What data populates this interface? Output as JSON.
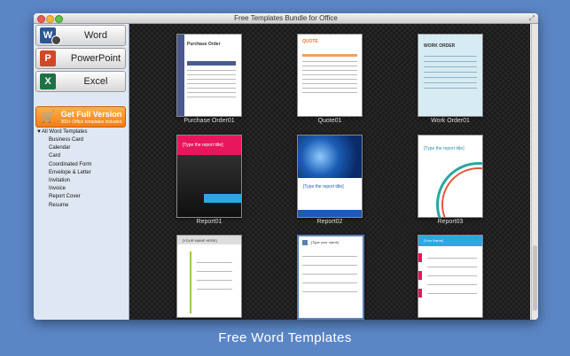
{
  "window": {
    "title": "Free Templates Bundle for Office"
  },
  "sidebar": {
    "apps": [
      {
        "label": "Word",
        "icon": "word-icon",
        "color": "#2b5797",
        "letter": "W"
      },
      {
        "label": "PowerPoint",
        "icon": "powerpoint-icon",
        "color": "#d24726",
        "letter": "P"
      },
      {
        "label": "Excel",
        "icon": "excel-icon",
        "color": "#1e7145",
        "letter": "X"
      }
    ],
    "get_full": {
      "title": "Get Full Version",
      "subtitle": "300+ Office templates included"
    },
    "category_header": "All Word Templates",
    "categories": [
      "Business Card",
      "Calendar",
      "Card",
      "Coordinated Form",
      "Envelope & Letter",
      "Invitation",
      "Invoice",
      "Report Cover",
      "Resume"
    ]
  },
  "templates": [
    {
      "label": "Purchase Order01",
      "thumb": {
        "heading": "Purchase Order"
      }
    },
    {
      "label": "Quote01",
      "thumb": {
        "heading": "QUOTE"
      }
    },
    {
      "label": "Work Order01",
      "thumb": {
        "heading": "WORK ORDER"
      }
    },
    {
      "label": "Report01",
      "thumb": {
        "heading": "[Type the report title]"
      }
    },
    {
      "label": "Report02",
      "thumb": {
        "heading": "[Type the report title]"
      }
    },
    {
      "label": "Report03",
      "thumb": {
        "heading": "[Type the report title]"
      }
    },
    {
      "label": "",
      "thumb": {
        "heading": "[YOUR NAME HERE]"
      }
    },
    {
      "label": "",
      "thumb": {
        "heading": "[Type your name]"
      }
    },
    {
      "label": "",
      "thumb": {
        "heading": "[Your Name]"
      }
    }
  ],
  "caption": "Free Word Templates",
  "colors": {
    "background": "#5b86c6",
    "accent_orange": "#f47d16",
    "content_bg": "#1c1c1c"
  }
}
